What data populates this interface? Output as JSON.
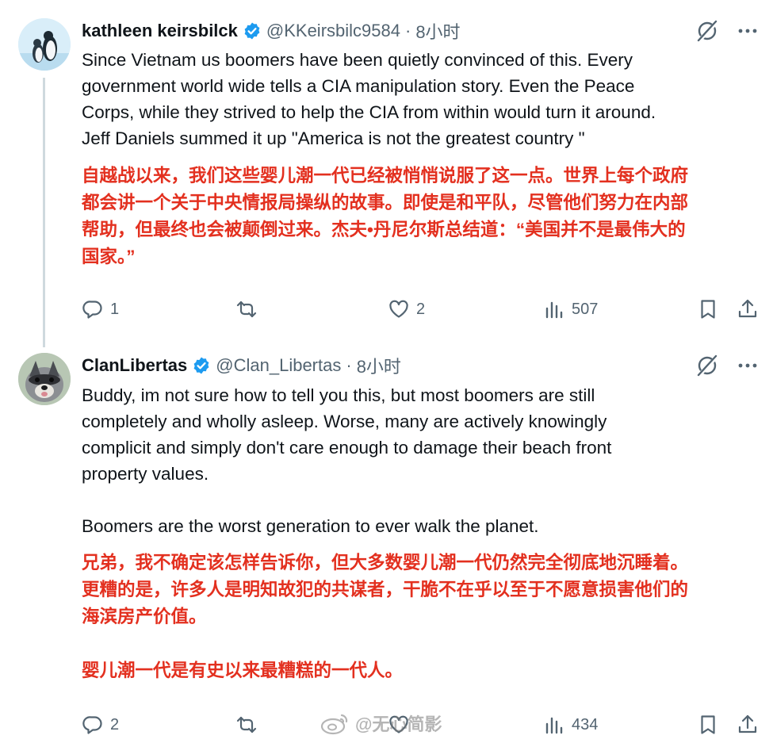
{
  "posts": [
    {
      "name": "kathleen keirsbilck",
      "handle": "@KKeirsbilc9584",
      "separator": "·",
      "time": "8小时",
      "body_en": [
        "Since Vietnam us boomers have been quietly convinced of this. Every",
        "government world wide tells a CIA manipulation story. Even the Peace",
        "Corps, while they strived to help the CIA from within would turn it around.",
        "Jeff Daniels summed it up \"America is not the greatest country \""
      ],
      "body_zh": [
        "自越战以来，我们这些婴儿潮一代已经被悄悄说服了这一点。世界上每个政府",
        "都会讲一个关于中央情报局操纵的故事。即使是和平队，尽管他们努力在内部",
        "帮助，但最终也会被颠倒过来。杰夫•丹尼尔斯总结道：“美国并不是最伟大的",
        "国家。”"
      ],
      "replies": "1",
      "reposts": "",
      "likes": "2",
      "views": "507"
    },
    {
      "name": "ClanLibertas",
      "handle": "@Clan_Libertas",
      "separator": "·",
      "time": "8小时",
      "body_en": [
        "Buddy, im not sure how to tell you this, but most boomers are still",
        "completely and wholly asleep. Worse, many are actively knowingly",
        "complicit and simply don't care enough to damage their beach front",
        "property values.",
        "Boomers are the worst generation to ever walk the planet."
      ],
      "body_zh": [
        "兄弟，我不确定该怎样告诉你，但大多数婴儿潮一代仍然完全彻底地沉睡着。",
        "更糟的是，许多人是明知故犯的共谋者，干脆不在乎以至于不愿意损害他们的",
        "海滨房产价值。",
        "婴儿潮一代是有史以来最糟糕的一代人。"
      ],
      "replies": "2",
      "reposts": "",
      "likes": "",
      "views": "434"
    }
  ],
  "watermark": "@无心简影",
  "colors": {
    "verified": "#1d9bf0",
    "translation_text": "#e3301f",
    "secondary_text": "#536471",
    "thread_line": "#cfd9de"
  },
  "icons": [
    "verified-badge-icon",
    "grok-icon",
    "more-icon",
    "reply-icon",
    "repost-icon",
    "like-icon",
    "views-icon",
    "bookmark-icon",
    "share-icon",
    "weibo-icon"
  ]
}
